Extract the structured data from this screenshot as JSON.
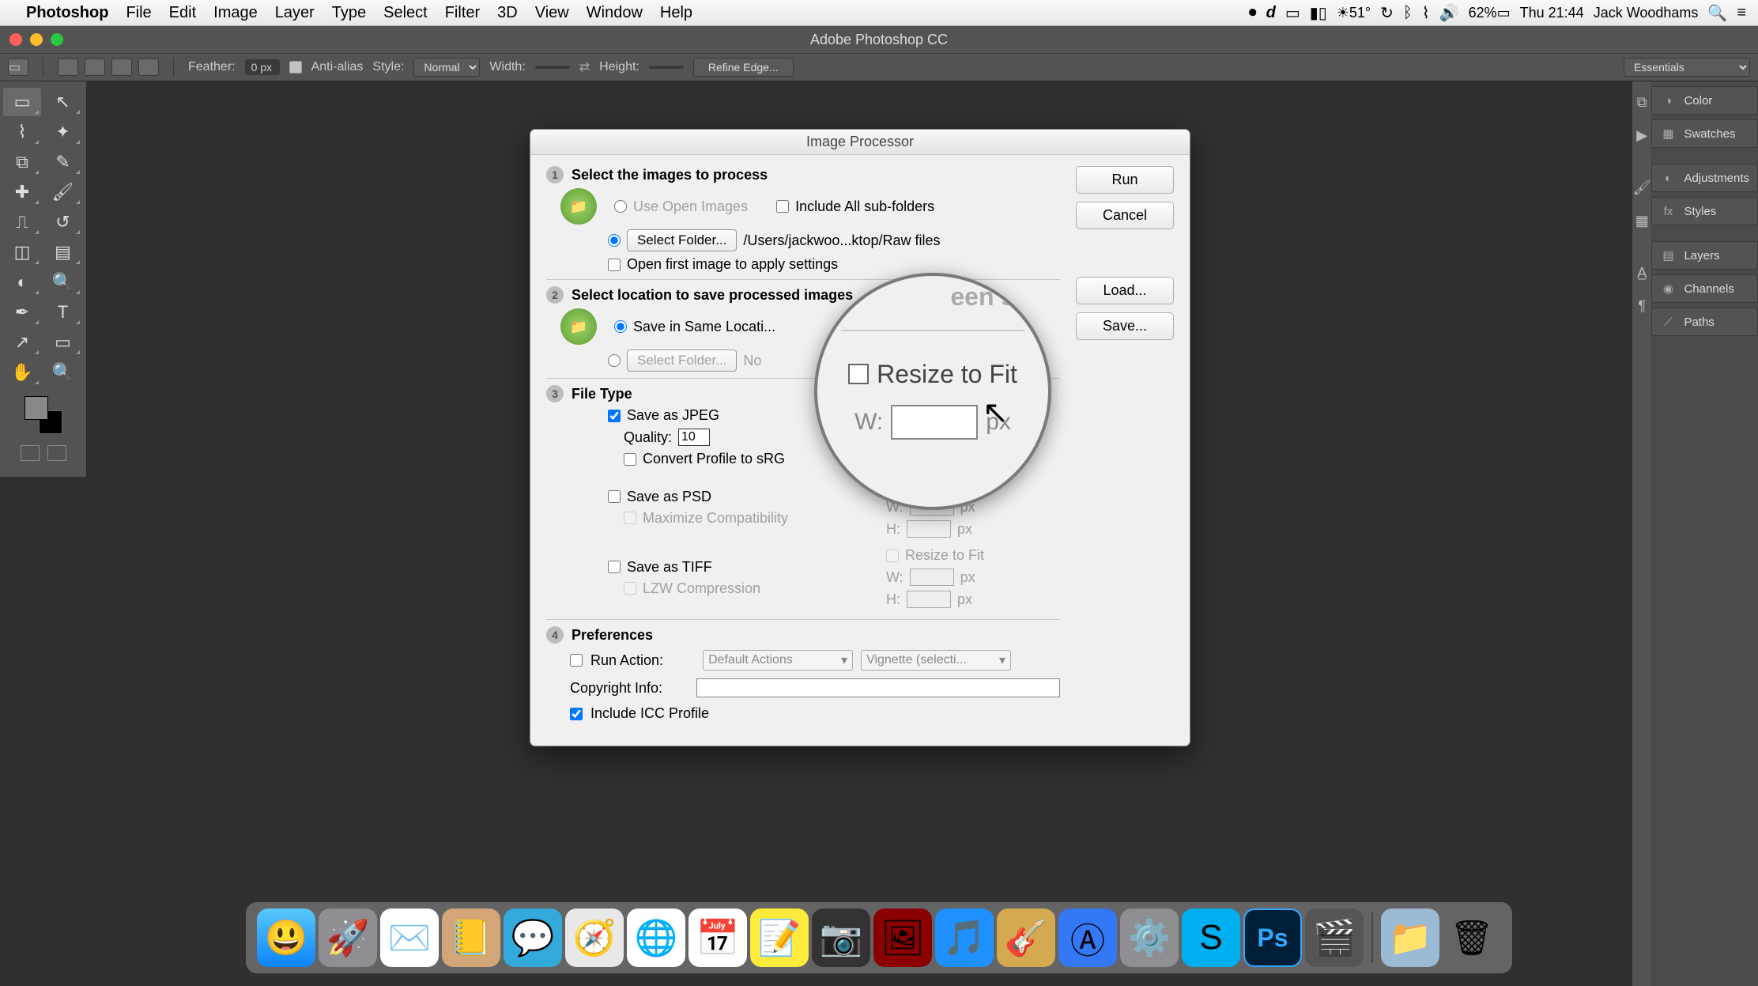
{
  "menubar": {
    "app": "Photoshop",
    "items": [
      "File",
      "Edit",
      "Image",
      "Layer",
      "Type",
      "Select",
      "Filter",
      "3D",
      "View",
      "Window",
      "Help"
    ],
    "status": {
      "temp": "51°",
      "battery": "62%",
      "time": "Thu 21:44",
      "user": "Jack Woodhams"
    }
  },
  "title_bar": "Adobe Photoshop CC",
  "options_bar": {
    "feather_label": "Feather:",
    "feather_value": "0 px",
    "anti_alias": "Anti-alias",
    "style_label": "Style:",
    "style_value": "Normal",
    "width_label": "Width:",
    "height_label": "Height:",
    "refine": "Refine Edge...",
    "workspace": "Essentials"
  },
  "panels": [
    "Color",
    "Swatches",
    "Adjustments",
    "Styles",
    "Layers",
    "Channels",
    "Paths"
  ],
  "dialog": {
    "title": "Image Processor",
    "run": "Run",
    "cancel": "Cancel",
    "load": "Load...",
    "save": "Save...",
    "step1": {
      "heading": "Select the images to process",
      "use_open": "Use Open Images",
      "include_sub": "Include All sub-folders",
      "select_folder": "Select Folder...",
      "path": "/Users/jackwoo...ktop/Raw files",
      "open_first": "Open first image to apply settings"
    },
    "step2": {
      "heading": "Select location to save processed images",
      "save_same": "Save in Same Locati...",
      "select_folder": "Select Folder...",
      "no_folder": "No"
    },
    "step3": {
      "heading": "File Type",
      "save_jpeg": "Save as JPEG",
      "quality_label": "Quality:",
      "quality_value": "10",
      "convert_profile": "Convert Profile to sRG",
      "save_psd": "Save as PSD",
      "maximize_compat": "Maximize Compatibility",
      "save_tiff": "Save as TIFF",
      "lzw": "LZW Compression",
      "resize_fit": "Resize to Fit",
      "w_label": "W:",
      "h_label": "H:",
      "px": "px"
    },
    "step4": {
      "heading": "Preferences",
      "run_action": "Run Action:",
      "action_set": "Default Actions",
      "action_name": "Vignette (selecti...",
      "copyright_label": "Copyright Info:",
      "include_icc": "Include ICC Profile"
    }
  },
  "magnifier": {
    "top_text": "een se",
    "resize": "Resize to Fit",
    "w": "W:",
    "px": "px"
  }
}
